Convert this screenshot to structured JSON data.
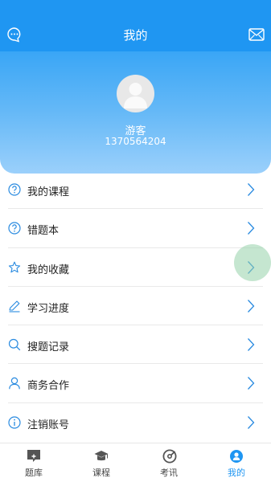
{
  "header": {
    "title": "我的",
    "left_icon": "chat-icon",
    "right_icon": "mail-icon"
  },
  "profile": {
    "name": "游客",
    "id": "1370564204"
  },
  "menu": [
    {
      "label": "我的课程",
      "icon": "question-circle-icon"
    },
    {
      "label": "错题本",
      "icon": "question-circle-icon"
    },
    {
      "label": "我的收藏",
      "icon": "star-icon"
    },
    {
      "label": "学习进度",
      "icon": "pencil-icon"
    },
    {
      "label": "搜题记录",
      "icon": "search-icon"
    },
    {
      "label": "商务合作",
      "icon": "user-icon"
    },
    {
      "label": "注销账号",
      "icon": "info-circle-icon"
    }
  ],
  "tabs": [
    {
      "label": "题库",
      "icon": "question-bank-icon"
    },
    {
      "label": "课程",
      "icon": "graduation-cap-icon"
    },
    {
      "label": "考讯",
      "icon": "disc-icon"
    },
    {
      "label": "我的",
      "icon": "user-badge-icon",
      "active": true
    }
  ],
  "colors": {
    "accent": "#1f96f2",
    "icon": "#2a8be0"
  }
}
